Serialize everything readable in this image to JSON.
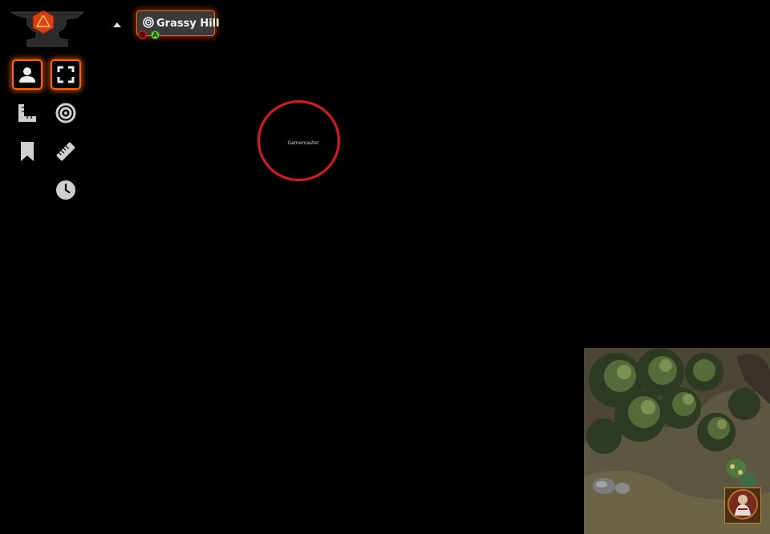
{
  "app": {
    "logo_icon": "anvil-d20-logo-icon"
  },
  "scene_controls": {
    "collapse_icon": "caret-up-icon",
    "tools": [
      {
        "name": "token-controls",
        "icon": "user-icon",
        "active": true
      },
      {
        "name": "fullscreen",
        "icon": "expand-icon",
        "active": true
      },
      {
        "name": "measure",
        "icon": "ruler-combined-icon",
        "active": false
      },
      {
        "name": "target",
        "icon": "bullseye-icon",
        "active": false
      },
      {
        "name": "notes",
        "icon": "bookmark-icon",
        "active": false
      },
      {
        "name": "ruler",
        "icon": "ruler-icon",
        "active": false
      },
      {
        "name": "time",
        "icon": "clock-icon",
        "active": false
      }
    ]
  },
  "scene_navigation": {
    "active_scene": "Grassy Hill",
    "scene_icon": "bullseye-icon",
    "badges": {
      "gm": "G",
      "all": "A"
    }
  },
  "canvas": {
    "token_label": "Gamemaster",
    "token_ring_color": "#e0171f"
  },
  "colors": {
    "accent": "#ff6400",
    "background": "#000000"
  }
}
